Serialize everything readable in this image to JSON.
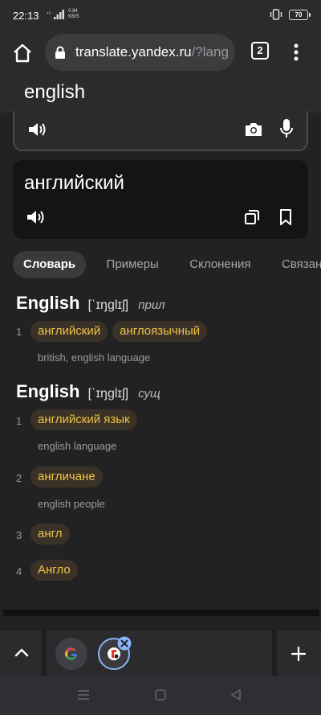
{
  "status": {
    "time": "22:13",
    "net_tag": "⁴⁶",
    "speed_value": "0.84",
    "speed_unit": "KB/S",
    "battery": "70"
  },
  "browser": {
    "url_main": "translate.yandex.ru",
    "url_rest": "/?lang",
    "tab_count": "2"
  },
  "source": {
    "text": "english"
  },
  "translation": {
    "text": "английский"
  },
  "tabs": [
    "Словарь",
    "Примеры",
    "Склонения",
    "Связанн"
  ],
  "dictionary": [
    {
      "word": "English",
      "transcription": "[ˈɪŋglɪʃ]",
      "pos": "прил",
      "senses": [
        {
          "num": "1",
          "translations": [
            "английский",
            "англоязычный"
          ],
          "synonyms": "british, english language"
        }
      ]
    },
    {
      "word": "English",
      "transcription": "[ˈɪŋglɪʃ]",
      "pos": "сущ",
      "senses": [
        {
          "num": "1",
          "translations": [
            "английский язык"
          ],
          "synonyms": "english language"
        },
        {
          "num": "2",
          "translations": [
            "англичане"
          ],
          "synonyms": "english people"
        },
        {
          "num": "3",
          "translations": [
            "англ"
          ],
          "synonyms": ""
        },
        {
          "num": "4",
          "translations": [
            "Англо"
          ],
          "synonyms": ""
        }
      ]
    }
  ],
  "colors": {
    "accent_chip_text": "#f0c24b",
    "chip_bg": "#3a3226",
    "background": "#222225"
  },
  "bottom": {
    "new_tab": "+"
  }
}
